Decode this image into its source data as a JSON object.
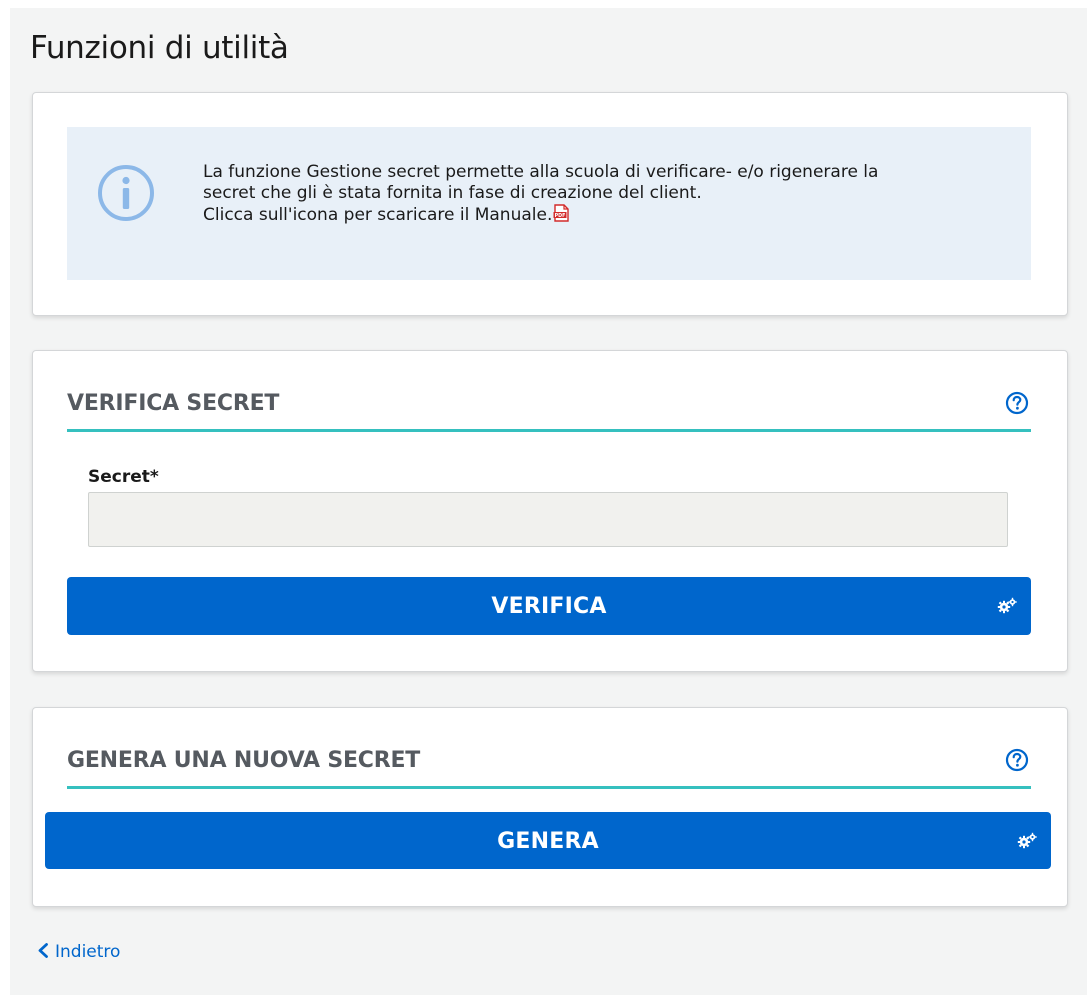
{
  "page": {
    "title": "Funzioni di utilità"
  },
  "info": {
    "icon": "info-circle-icon",
    "lines": [
      "La funzione Gestione secret permette alla scuola di verificare- e/o rigenerare la",
      "secret che gli è stata fornita in fase di creazione del client.",
      "Clicca sull'icona per scaricare il Manuale."
    ],
    "pdf_icon": "pdf-file-icon"
  },
  "verify": {
    "title": "VERIFICA SECRET",
    "help_icon": "question-circle-icon",
    "field_label": "Secret*",
    "field_value": "",
    "field_placeholder": "",
    "button_label": "VERIFICA",
    "button_icon": "gears-icon"
  },
  "generate": {
    "title": "GENERA UNA NUOVA SECRET",
    "help_icon": "question-circle-icon",
    "button_label": "GENERA",
    "button_icon": "gears-icon"
  },
  "back": {
    "label": "Indietro",
    "icon": "chevron-left-icon"
  },
  "colors": {
    "primary": "#0066cc",
    "accent_line": "#35c0bf",
    "info_bg": "#e8f0f8",
    "info_icon": "#8cb8e8",
    "page_bg": "#f3f4f4"
  }
}
